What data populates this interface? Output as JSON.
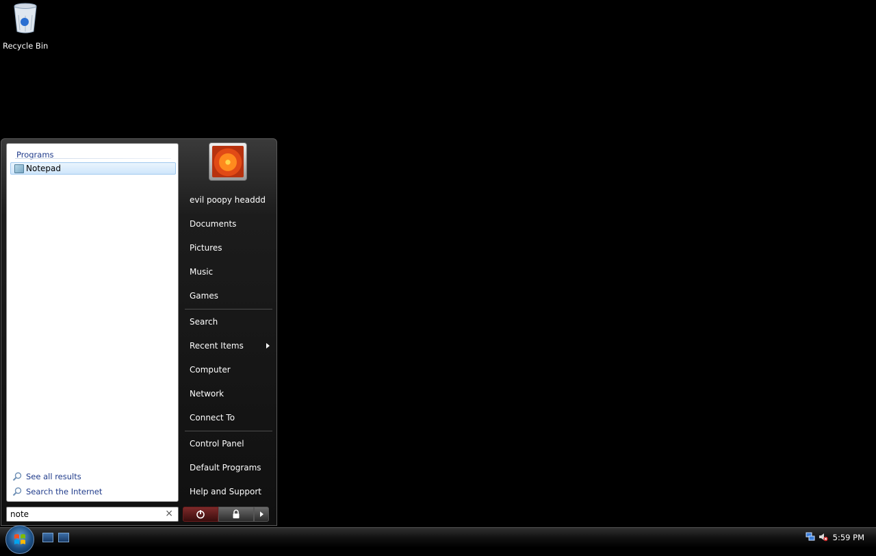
{
  "desktop": {
    "icons": [
      {
        "label": "Recycle Bin",
        "icon": "recycle-bin-icon"
      }
    ]
  },
  "start_menu": {
    "search_results": {
      "group_header": "Programs",
      "items": [
        {
          "label": "Notepad",
          "icon": "notepad-icon"
        }
      ],
      "see_all": "See all results",
      "search_internet": "Search the Internet"
    },
    "search_box": {
      "value": "note",
      "clear_label": "×"
    },
    "user": {
      "name": "evil poopy headdd",
      "picture": "flower-user-picture"
    },
    "right_items": [
      {
        "label": "Documents"
      },
      {
        "label": "Pictures"
      },
      {
        "label": "Music"
      },
      {
        "label": "Games"
      }
    ],
    "right_items_2": [
      {
        "label": "Search"
      },
      {
        "label": "Recent Items"
      },
      {
        "label": "Computer"
      },
      {
        "label": "Network"
      },
      {
        "label": "Connect To"
      }
    ],
    "right_items_3": [
      {
        "label": "Control Panel"
      },
      {
        "label": "Default Programs"
      },
      {
        "label": "Help and Support"
      }
    ]
  },
  "taskbar": {
    "clock": "5:59 PM"
  },
  "colors": {
    "accent_blue": "#1e3a8a",
    "power_red": "#7d2a2a"
  }
}
